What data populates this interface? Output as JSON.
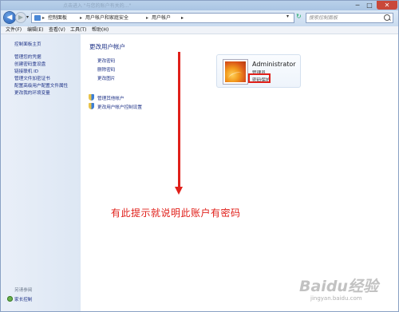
{
  "titlebar": {
    "ghost_text": "点击进入 \"与您的账户有关的…\"  ",
    "min": "─",
    "max": "□",
    "close": "✕"
  },
  "address": {
    "back": "◀",
    "forward": "▶",
    "history": "▾",
    "breadcrumbs": [
      "控制面板",
      "用户帐户和家庭安全",
      "用户帐户"
    ],
    "search_placeholder": "搜索控制面板",
    "refresh": "↻"
  },
  "menu": [
    "文件(F)",
    "编辑(E)",
    "查看(V)",
    "工具(T)",
    "帮助(H)"
  ],
  "sidebar": {
    "home": "控制面板主页",
    "items": [
      "管理您的凭据",
      "创建密码重设盘",
      "链接联机 ID",
      "管理文件加密证书",
      "配置高级用户配置文件属性",
      "更改我的环境变量"
    ],
    "see_also": "另请参阅",
    "parental": "家长控制"
  },
  "main": {
    "title": "更改用户帐户",
    "links": [
      "更改密码",
      "删除密码",
      "更改图片"
    ],
    "shield_links": [
      "管理其他帐户",
      "更改用户帐户控制设置"
    ],
    "user": {
      "name": "Administrator",
      "role": "管理员",
      "status": "密码保护"
    }
  },
  "annotation": "有此提示就说明此账户有密码",
  "watermark": {
    "text": "Baidu经验",
    "sub": "jingyan.baidu.com"
  },
  "colors": {
    "link": "#1e3287",
    "annotation": "#e0201a",
    "sidebar": "#e3ebf6"
  }
}
